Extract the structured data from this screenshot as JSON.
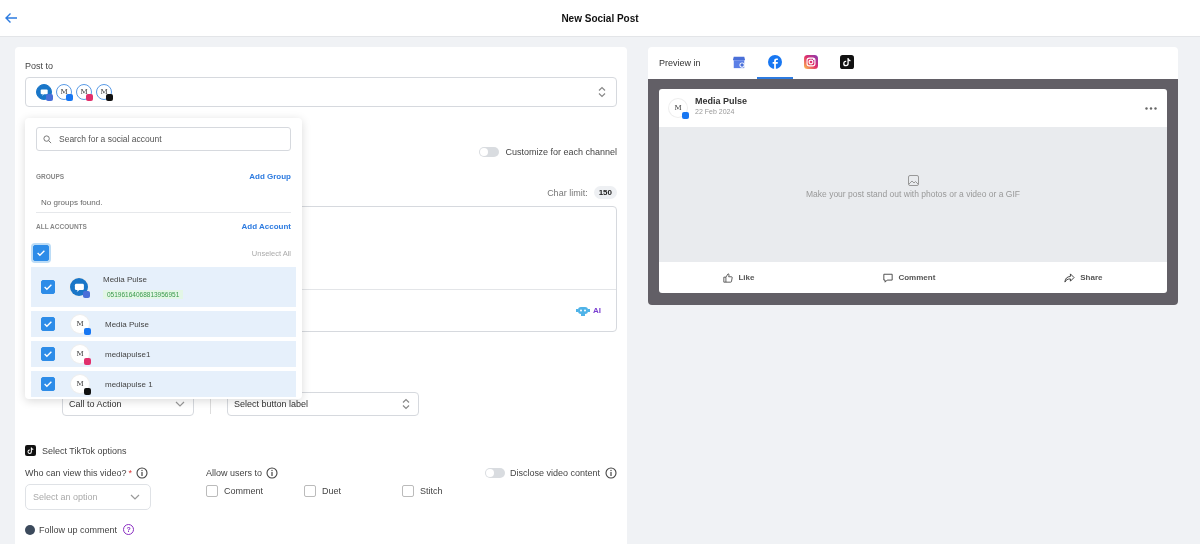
{
  "header": {
    "title": "New Social Post"
  },
  "post_to": {
    "label": "Post to",
    "avatars": [
      {
        "kind": "gmb"
      },
      {
        "kind": "facebook",
        "letter": "M"
      },
      {
        "kind": "instagram",
        "letter": "M"
      },
      {
        "kind": "tiktok",
        "letter": "M"
      }
    ]
  },
  "customize": {
    "label": "Customize for each channel",
    "on": false
  },
  "char_limit": {
    "label": "Char limit:",
    "value": "150"
  },
  "ai_button": {
    "label": "AI"
  },
  "cta": {
    "type_value": "Call to Action",
    "label_placeholder": "Select button label"
  },
  "account_dropdown": {
    "search_placeholder": "Search for a social account",
    "groups_title": "GROUPS",
    "add_group": "Add Group",
    "groups_empty": "No groups found.",
    "accounts_title": "ALL ACCOUNTS",
    "add_account": "Add Account",
    "select_all_checked": true,
    "unselect_all": "Unselect All",
    "accounts": [
      {
        "kind": "gmb",
        "name": "Media Pulse",
        "id": "05196164068813956951",
        "checked": true
      },
      {
        "kind": "facebook",
        "letter": "M",
        "name": "Media Pulse",
        "checked": true
      },
      {
        "kind": "instagram",
        "letter": "M",
        "name": "mediapulse1",
        "checked": true
      },
      {
        "kind": "tiktok",
        "letter": "M",
        "name": "mediapulse 1",
        "checked": true
      }
    ]
  },
  "tiktok": {
    "title": "Select TikTok options",
    "who_label": "Who can view this video?",
    "required_mark": "*",
    "who_placeholder": "Select an option",
    "allow_label": "Allow users to",
    "options": [
      {
        "label": "Comment",
        "checked": false
      },
      {
        "label": "Duet",
        "checked": false
      },
      {
        "label": "Stitch",
        "checked": false
      }
    ],
    "disclose": {
      "label": "Disclose video content",
      "on": false
    }
  },
  "follow_up": {
    "label": "Follow up comment",
    "help": "?"
  },
  "preview": {
    "label": "Preview in",
    "tabs": [
      {
        "kind": "gmb",
        "selected": false
      },
      {
        "kind": "facebook",
        "selected": true
      },
      {
        "kind": "instagram",
        "selected": false
      },
      {
        "kind": "tiktok",
        "selected": false
      }
    ],
    "post": {
      "letter": "M",
      "author": "Media Pulse",
      "date": "22 Feb 2024",
      "placeholder": "Make your post stand out with photos or a video or a GIF",
      "actions": [
        {
          "kind": "like",
          "label": "Like"
        },
        {
          "kind": "comment",
          "label": "Comment"
        },
        {
          "kind": "share",
          "label": "Share"
        }
      ]
    }
  }
}
